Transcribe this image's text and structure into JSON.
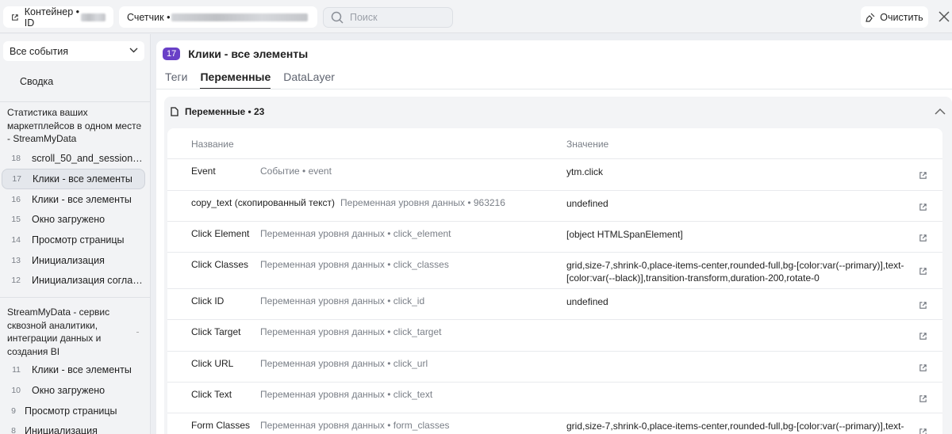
{
  "topbar": {
    "container_label": "Контейнер • ID",
    "counter_label": "Счетчик •",
    "search_placeholder": "Поиск",
    "clear_label": "Очистить"
  },
  "sidebar": {
    "filter_value": "Все события",
    "summary": "Сводка",
    "groups": [
      {
        "title": "Статистика ваших маркетплейсов в одном месте - StreamMyData",
        "events": [
          {
            "num": "18",
            "label": "scroll_50_and_session_duration"
          },
          {
            "num": "17",
            "label": "Клики - все элементы",
            "active": true
          },
          {
            "num": "16",
            "label": "Клики - все элементы"
          },
          {
            "num": "15",
            "label": "Окно загружено"
          },
          {
            "num": "14",
            "label": "Просмотр страницы"
          },
          {
            "num": "13",
            "label": "Инициализация"
          },
          {
            "num": "12",
            "label": "Инициализация согласия"
          }
        ]
      },
      {
        "title": "StreamMyData - сервис сквозной аналитики, интеграции данных и создания BI",
        "events": [
          {
            "num": "11",
            "label": "Клики - все элементы"
          },
          {
            "num": "10",
            "label": "Окно загружено"
          },
          {
            "num": "9",
            "label": "Просмотр страницы"
          },
          {
            "num": "8",
            "label": "Инициализация"
          }
        ]
      }
    ]
  },
  "main": {
    "badge": "17",
    "title": "Клики - все элементы",
    "tabs": [
      "Теги",
      "Переменные",
      "DataLayer"
    ],
    "panel_title": "Переменные • 23",
    "col_name": "Название",
    "col_value": "Значение",
    "rows": [
      {
        "name": "Event",
        "source": "Событие • event",
        "value": "ytm.click"
      },
      {
        "name": "copy_text (скопированный текст)",
        "source": "Переменная уровня данных • 963216",
        "value": "undefined"
      },
      {
        "name": "Click Element",
        "source": "Переменная уровня данных • click_element",
        "value": "[object HTMLSpanElement]"
      },
      {
        "name": "Click Classes",
        "source": "Переменная уровня данных • click_classes",
        "value": "grid,size-7,shrink-0,place-items-center,rounded-full,bg-[color:var(--primary)],text-[color:var(--black)],transition-transform,duration-200,rotate-0"
      },
      {
        "name": "Click ID",
        "source": "Переменная уровня данных • click_id",
        "value": "undefined"
      },
      {
        "name": "Click Target",
        "source": "Переменная уровня данных • click_target",
        "value": ""
      },
      {
        "name": "Click URL",
        "source": "Переменная уровня данных • click_url",
        "value": ""
      },
      {
        "name": "Click Text",
        "source": "Переменная уровня данных • click_text",
        "value": ""
      },
      {
        "name": "Form Classes",
        "source": "Переменная уровня данных • form_classes",
        "value": "grid,size-7,shrink-0,place-items-center,rounded-full,bg-[color:var(--primary)],text-"
      }
    ]
  },
  "colors": {
    "accent": "#6940c7",
    "muted": "#7a7f87"
  }
}
